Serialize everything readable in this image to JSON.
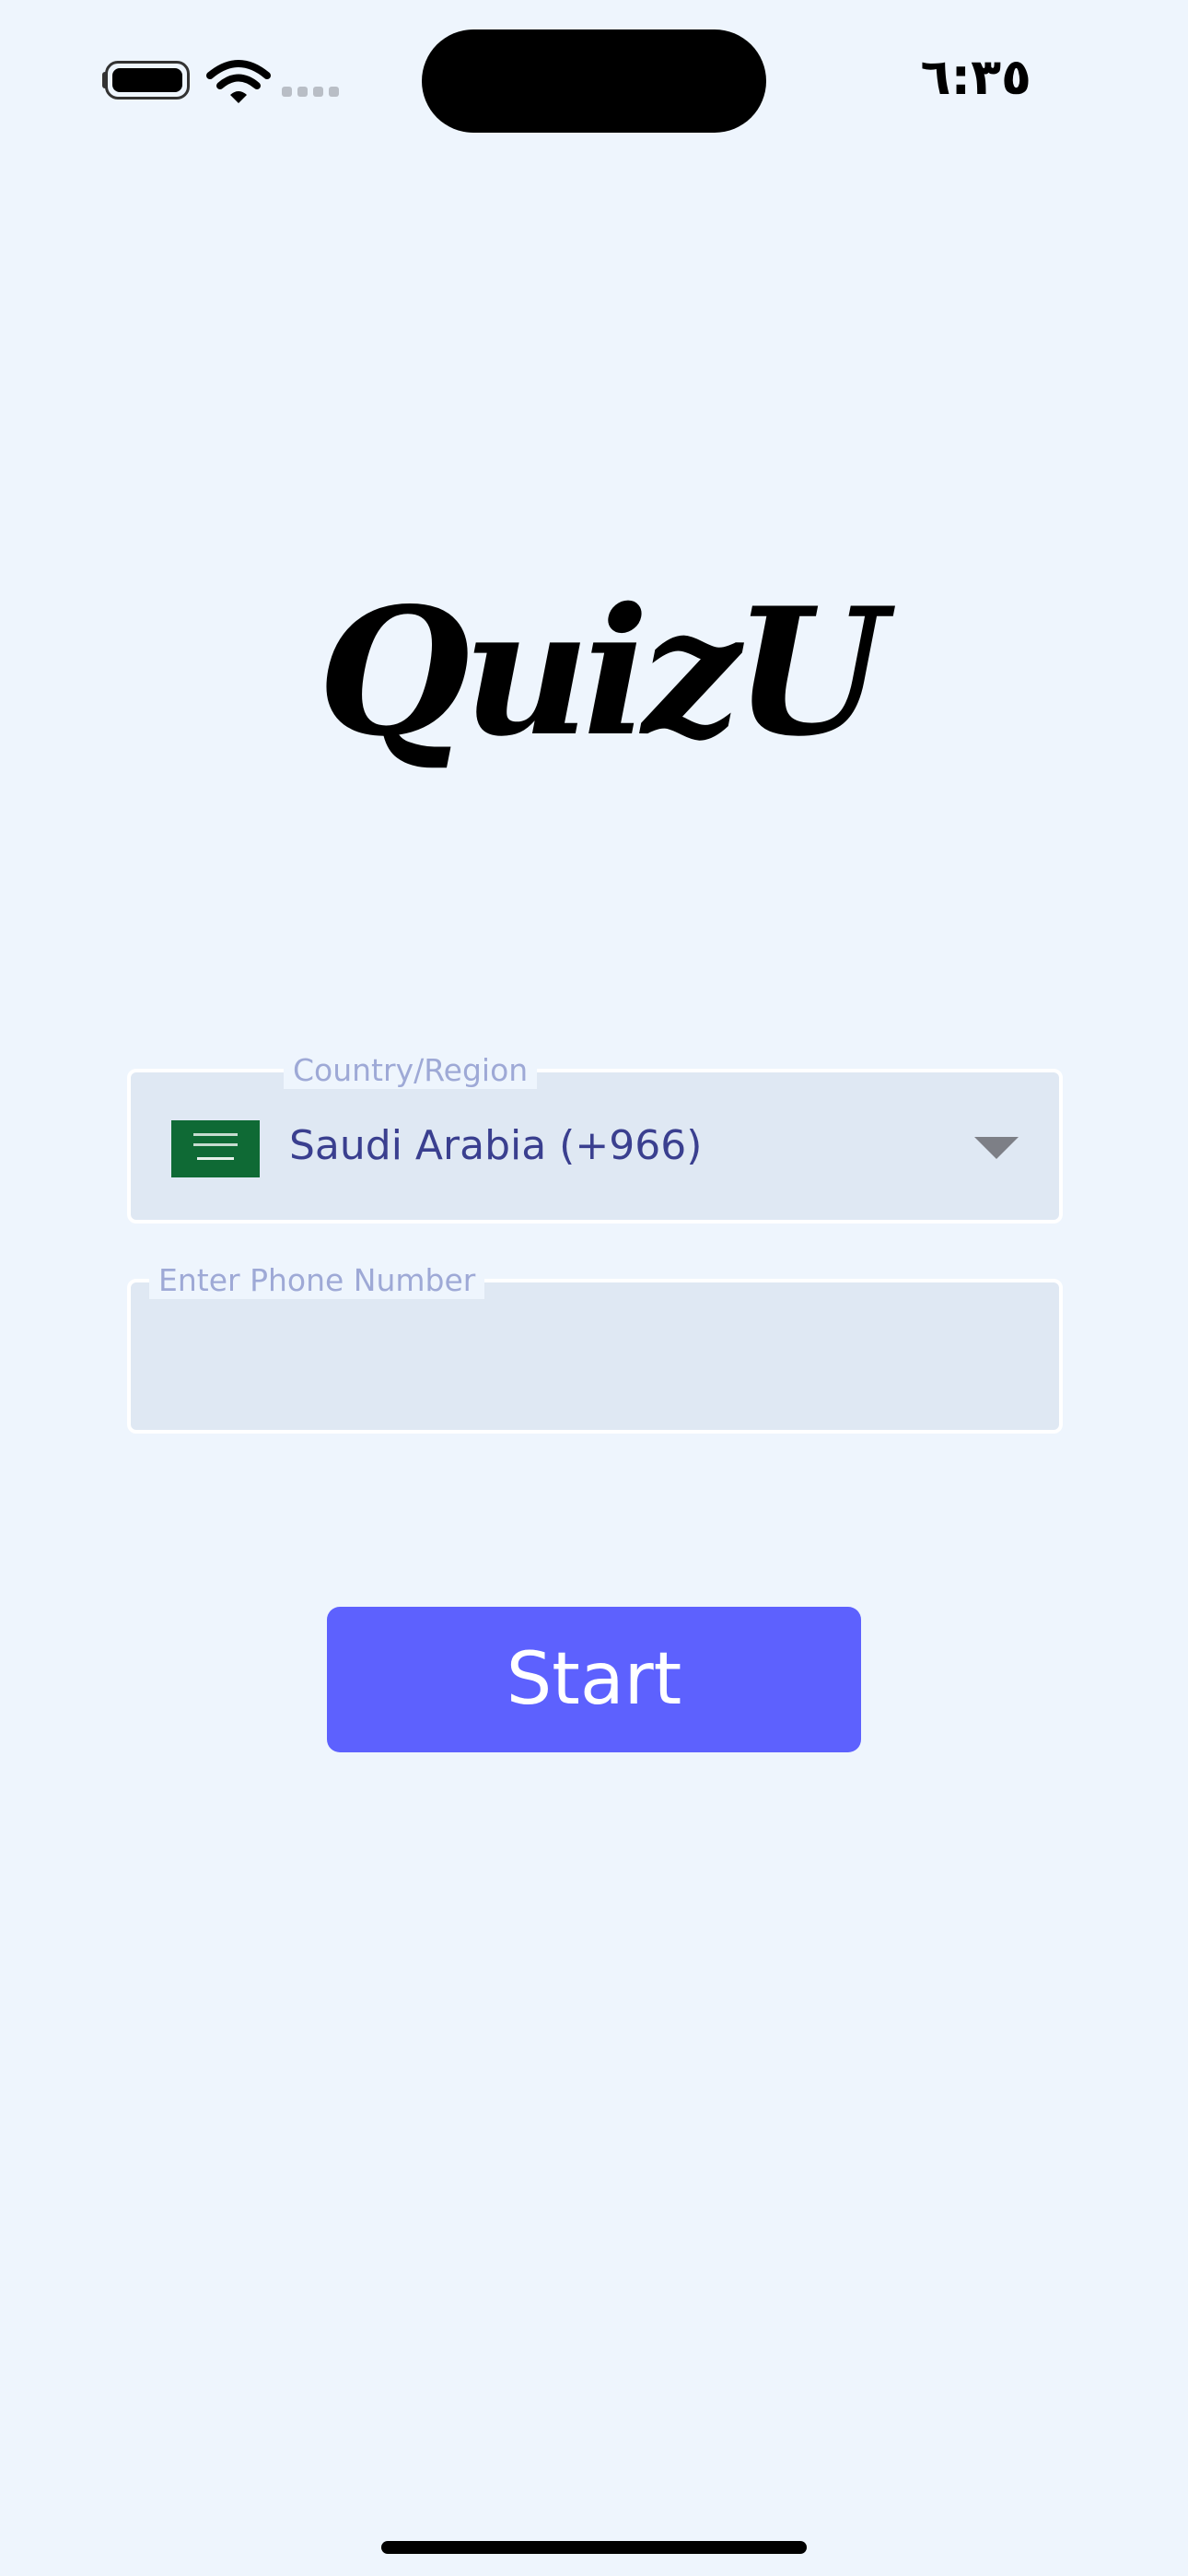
{
  "status_bar": {
    "time": "٦:٣٥",
    "battery_icon": "battery-full-icon",
    "wifi_icon": "wifi-icon",
    "signal_icon": "cellular-signal-icon"
  },
  "app": {
    "logo_text": "QuizU"
  },
  "form": {
    "country_legend": "Country/Region",
    "country_value": "Saudi Arabia (+966)",
    "country_flag_icon": "saudi-arabia-flag-icon",
    "dropdown_icon": "caret-down-icon",
    "phone_legend": "Enter Phone Number",
    "phone_value": ""
  },
  "actions": {
    "start_label": "Start"
  },
  "colors": {
    "background": "#eef5fd",
    "field_background": "#dfe8f3",
    "field_label": "#9ea9d6",
    "field_text": "#3a3f8f",
    "primary_button": "#5d61fe",
    "flag_green": "#0f6a35"
  }
}
